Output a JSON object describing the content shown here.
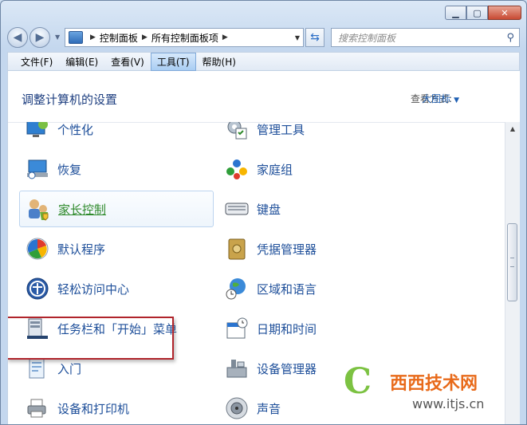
{
  "breadcrumb": [
    "控制面板",
    "所有控制面板项"
  ],
  "search": {
    "placeholder": "搜索控制面板"
  },
  "menu": [
    "文件(F)",
    "编辑(E)",
    "查看(V)",
    "工具(T)",
    "帮助(H)"
  ],
  "active_menu": "工具(T)",
  "page_title": "调整计算机的设置",
  "view_by": {
    "label": "查看方式:",
    "value": "大图标"
  },
  "items_left": [
    {
      "label": "个性化",
      "icon": "personalization-icon"
    },
    {
      "label": "恢复",
      "icon": "recovery-icon"
    },
    {
      "label": "家长控制",
      "icon": "parental-controls-icon"
    },
    {
      "label": "默认程序",
      "icon": "default-programs-icon"
    },
    {
      "label": "轻松访问中心",
      "icon": "ease-of-access-icon"
    },
    {
      "label": "任务栏和「开始」菜单",
      "icon": "taskbar-icon"
    },
    {
      "label": "入门",
      "icon": "getting-started-icon"
    },
    {
      "label": "设备和打印机",
      "icon": "printer-icon"
    }
  ],
  "items_right": [
    {
      "label": "管理工具",
      "icon": "admin-tools-icon"
    },
    {
      "label": "家庭组",
      "icon": "homegroup-icon"
    },
    {
      "label": "键盘",
      "icon": "keyboard-icon"
    },
    {
      "label": "凭据管理器",
      "icon": "credential-manager-icon"
    },
    {
      "label": "区域和语言",
      "icon": "region-language-icon"
    },
    {
      "label": "日期和时间",
      "icon": "date-time-icon"
    },
    {
      "label": "设备管理器",
      "icon": "device-manager-icon"
    },
    {
      "label": "声音",
      "icon": "sound-icon"
    }
  ],
  "watermark": {
    "brand": "西西技术网",
    "url": "www.itjs.cn"
  }
}
